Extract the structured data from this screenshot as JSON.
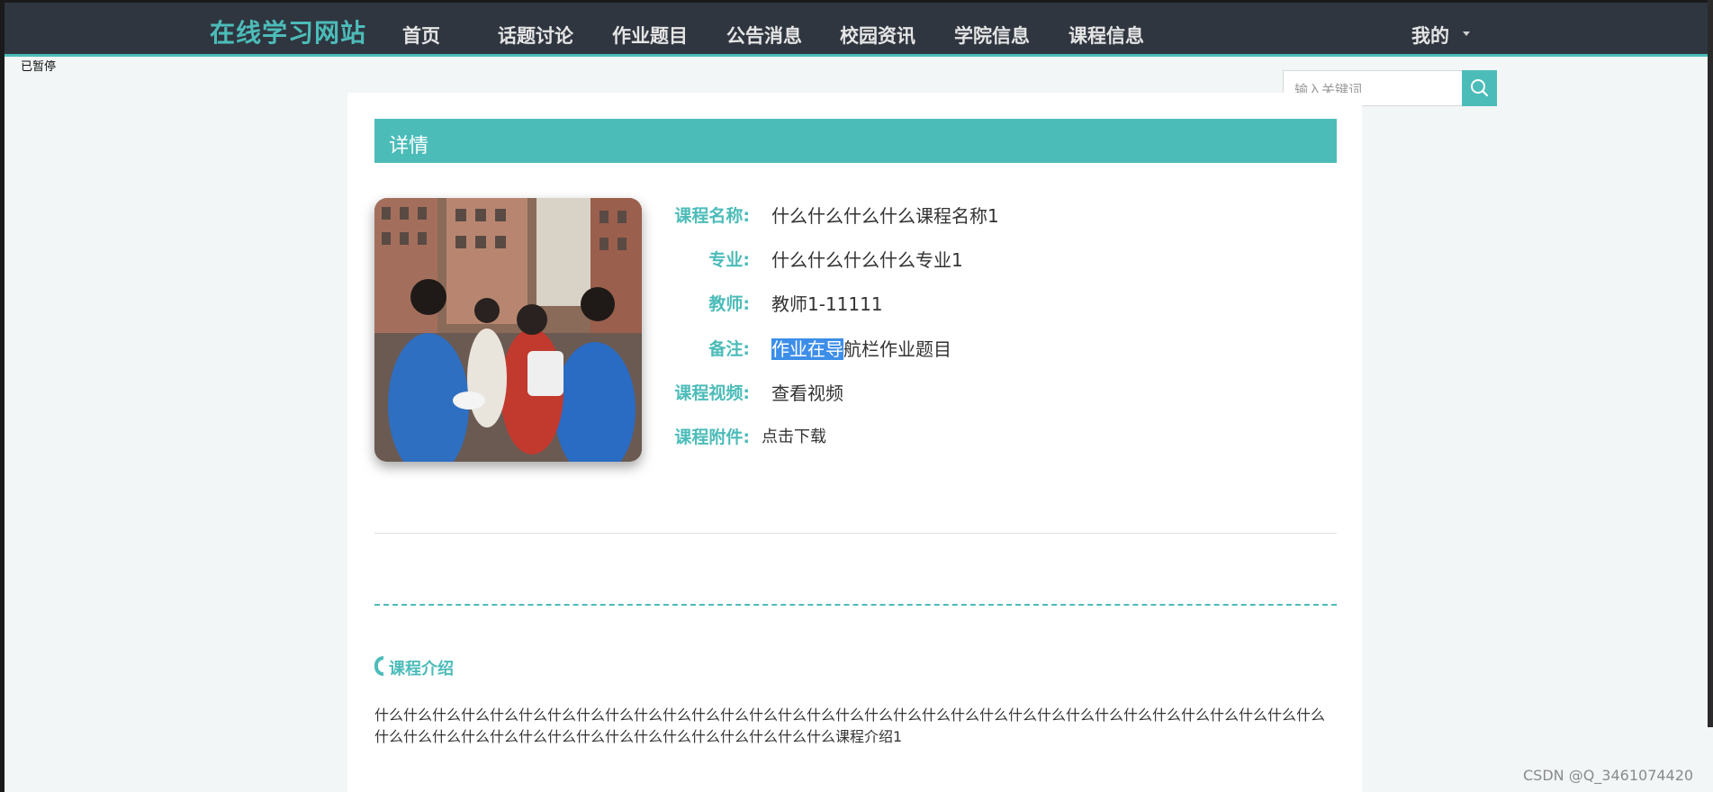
{
  "nav": {
    "brand": "在线学习网站",
    "items": [
      "首页",
      "话题讨论",
      "作业题目",
      "公告消息",
      "校园资讯",
      "学院信息",
      "课程信息"
    ],
    "mine": "我的"
  },
  "overlay_label": "已暂停",
  "search": {
    "placeholder": "输入关键词",
    "icon": "search-icon"
  },
  "detail": {
    "header": "详情",
    "fields": [
      {
        "label": "课程名称:",
        "value": "什么什么什么什么课程名称1"
      },
      {
        "label": "专业:",
        "value": "什么什么什么什么专业1"
      },
      {
        "label": "教师:",
        "value": "教师1-11111"
      },
      {
        "label": "备注:",
        "value_selected": "作业在导",
        "value_rest": "航栏作业题目"
      },
      {
        "label": "课程视频:",
        "value": "查看视频"
      },
      {
        "label": "课程附件:",
        "value": "点击下载"
      }
    ]
  },
  "intro": {
    "title": "课程介绍",
    "text": "什么什么什么什么什么什么什么什么什么什么什么什么什么什么什么什么什么什么什么什么什么什么什么什么什么什么什么什么什么什么什么什么什么什么什么什么什么什么什么什么什么什么什么什么什么什么什么什么什么课程介绍1"
  },
  "watermark": "CSDN @Q_3461074420",
  "colors": {
    "accent": "#4cbcb9",
    "navbar": "#2f3640",
    "selection": "#3d8ee8"
  }
}
